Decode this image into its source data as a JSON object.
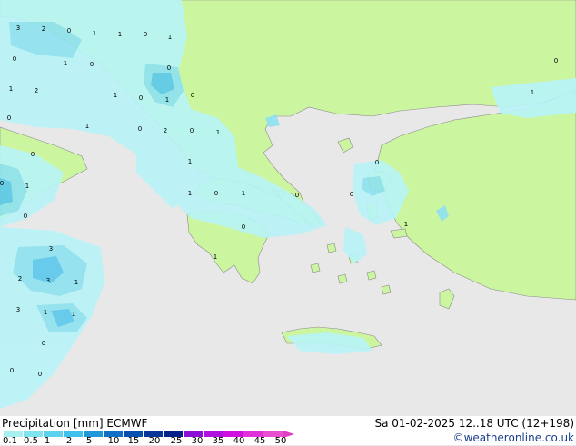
{
  "footer": {
    "title": "Precipitation [mm]  ECMWF",
    "datetime": "Sa 01-02-2025 12..18 UTC (12+198)",
    "credit": "©weatheronline.co.uk"
  },
  "legend": {
    "ticks": [
      "0.1",
      "0.5",
      "1",
      "2",
      "5",
      "10",
      "15",
      "20",
      "25",
      "30",
      "35",
      "40",
      "45",
      "50"
    ],
    "colors": [
      "#a8f0f0",
      "#80e4f0",
      "#5cd2ee",
      "#40c0ec",
      "#2098d8",
      "#1070c8",
      "#0850b0",
      "#063498",
      "#04208a",
      "#8c10d8",
      "#b010e0",
      "#d010e0",
      "#e030d8",
      "#e850d0"
    ]
  },
  "map": {
    "colors": {
      "sea": "#e8e8e8",
      "land": "#ccf5a0",
      "precip_light": "#b8f4f8",
      "precip_mid": "#8ee2f0",
      "precip_heavy": "#5cc8ec"
    },
    "point_values": [
      "3",
      "2",
      "0",
      "1",
      "1",
      "0",
      "1",
      "0",
      "1",
      "0",
      "0",
      "1",
      "2",
      "1",
      "0",
      "1",
      "0",
      "0",
      "1",
      "0",
      "2",
      "0",
      "1",
      "0",
      "1",
      "0",
      "0",
      "1",
      "1",
      "0",
      "1",
      "0",
      "0",
      "0",
      "0",
      "3",
      "2",
      "3",
      "1",
      "3",
      "1",
      "1",
      "0",
      "0",
      "0",
      "1",
      "1",
      "1",
      "0"
    ]
  }
}
